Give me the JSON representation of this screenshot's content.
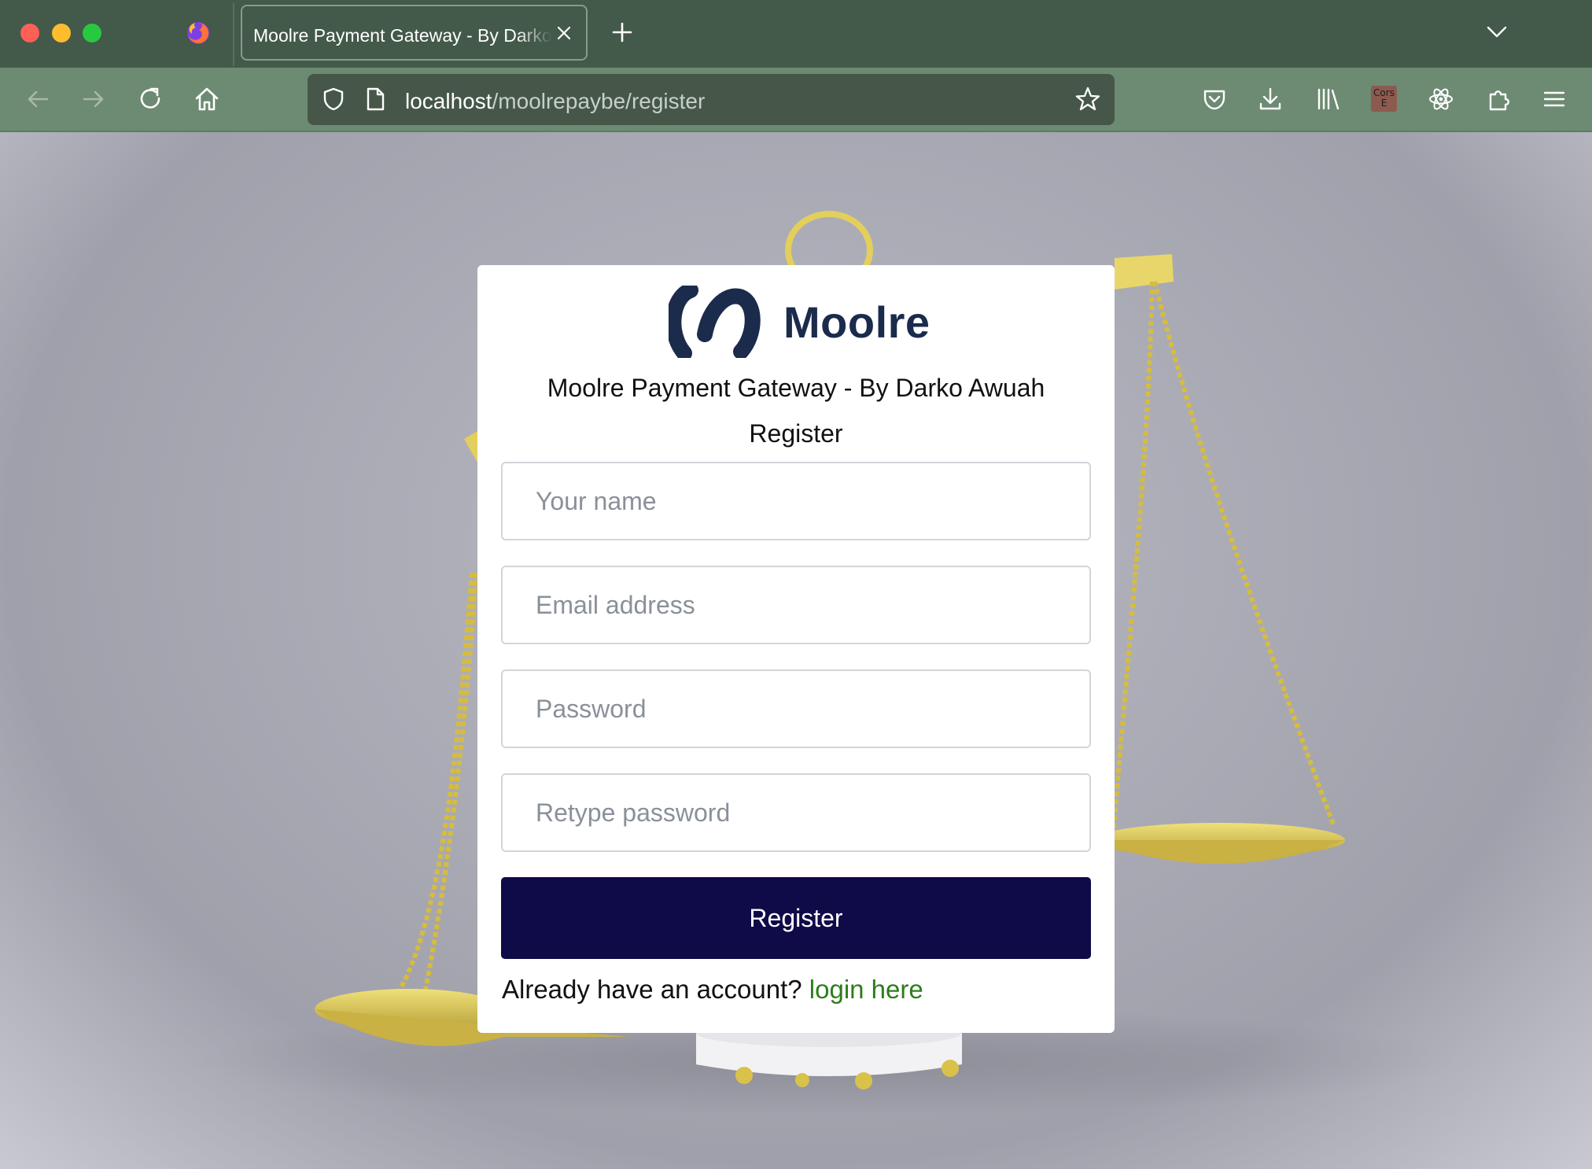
{
  "browser": {
    "tab_title": "Moolre Payment Gateway - By Darko Awuah",
    "url_host": "localhost",
    "url_path": "/moolrepaybe/register",
    "cors_badge": "Cors E",
    "accent_color": "#43594a"
  },
  "icons": {
    "traffic_lights": [
      "close-light",
      "minimize-light",
      "zoom-light"
    ],
    "toolbar": [
      "back-icon",
      "forward-icon",
      "reload-icon",
      "home-icon",
      "shield-icon",
      "page-icon",
      "bookmark-star-icon",
      "pocket-icon",
      "download-icon",
      "library-icon",
      "react-devtools-icon",
      "extensions-icon",
      "menu-icon"
    ]
  },
  "card": {
    "brand_name": "Moolre",
    "subtitle": "Moolre Payment Gateway - By Darko Awuah",
    "form_title": "Register",
    "fields": {
      "name_placeholder": "Your name",
      "email_placeholder": "Email address",
      "password_placeholder": "Password",
      "retype_placeholder": "Retype password"
    },
    "submit_label": "Register",
    "footer_text": "Already have an account?",
    "login_link": "login here",
    "button_color": "#0f0a48",
    "link_color": "#2e7d1b"
  }
}
